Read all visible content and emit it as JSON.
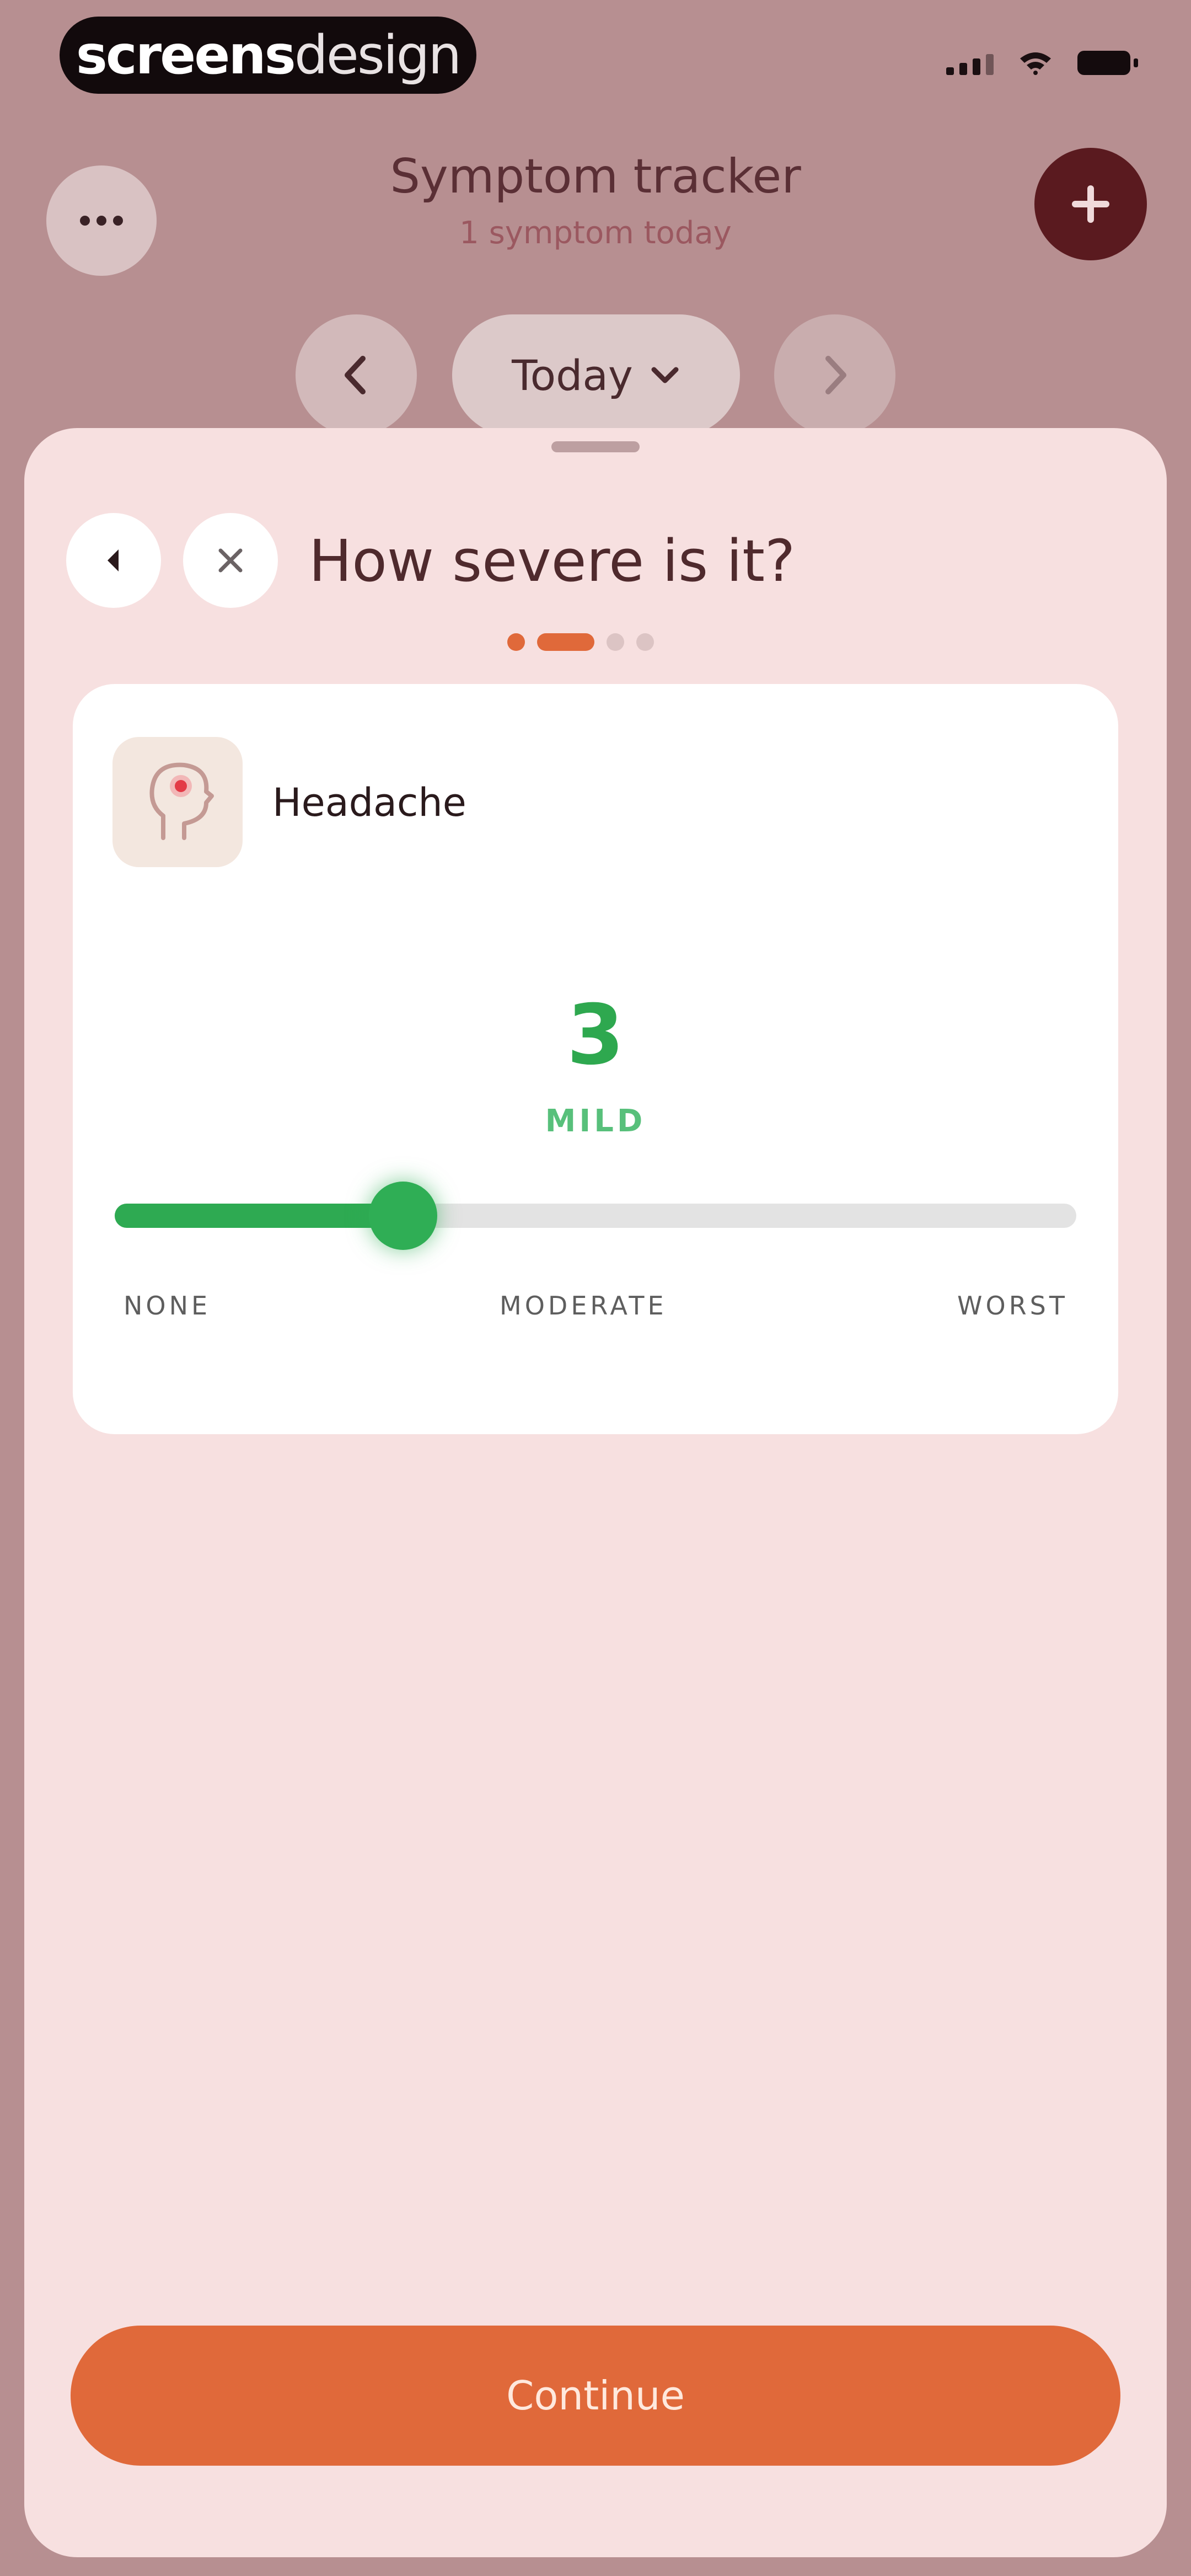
{
  "status_bar": {
    "brand_part1": "screens",
    "brand_part2": "design"
  },
  "header": {
    "title": "Symptom tracker",
    "subtitle": "1 symptom today"
  },
  "date_nav": {
    "label": "Today"
  },
  "sheet": {
    "question": "How severe is it?",
    "step": {
      "current": 2,
      "total": 4
    }
  },
  "symptom": {
    "name": "Headache",
    "icon": "head-pain-icon"
  },
  "severity": {
    "value": "3",
    "label": "MILD",
    "min": 0,
    "max": 10,
    "scale_labels": {
      "low": "NONE",
      "mid": "MODERATE",
      "high": "WORST"
    }
  },
  "actions": {
    "continue_label": "Continue"
  },
  "colors": {
    "backdrop": "#b78f91",
    "sheet": "#f7e0e0",
    "accent": "#e0693a",
    "severity_green": "#2ea84f",
    "add_button": "#5a1a1f"
  }
}
